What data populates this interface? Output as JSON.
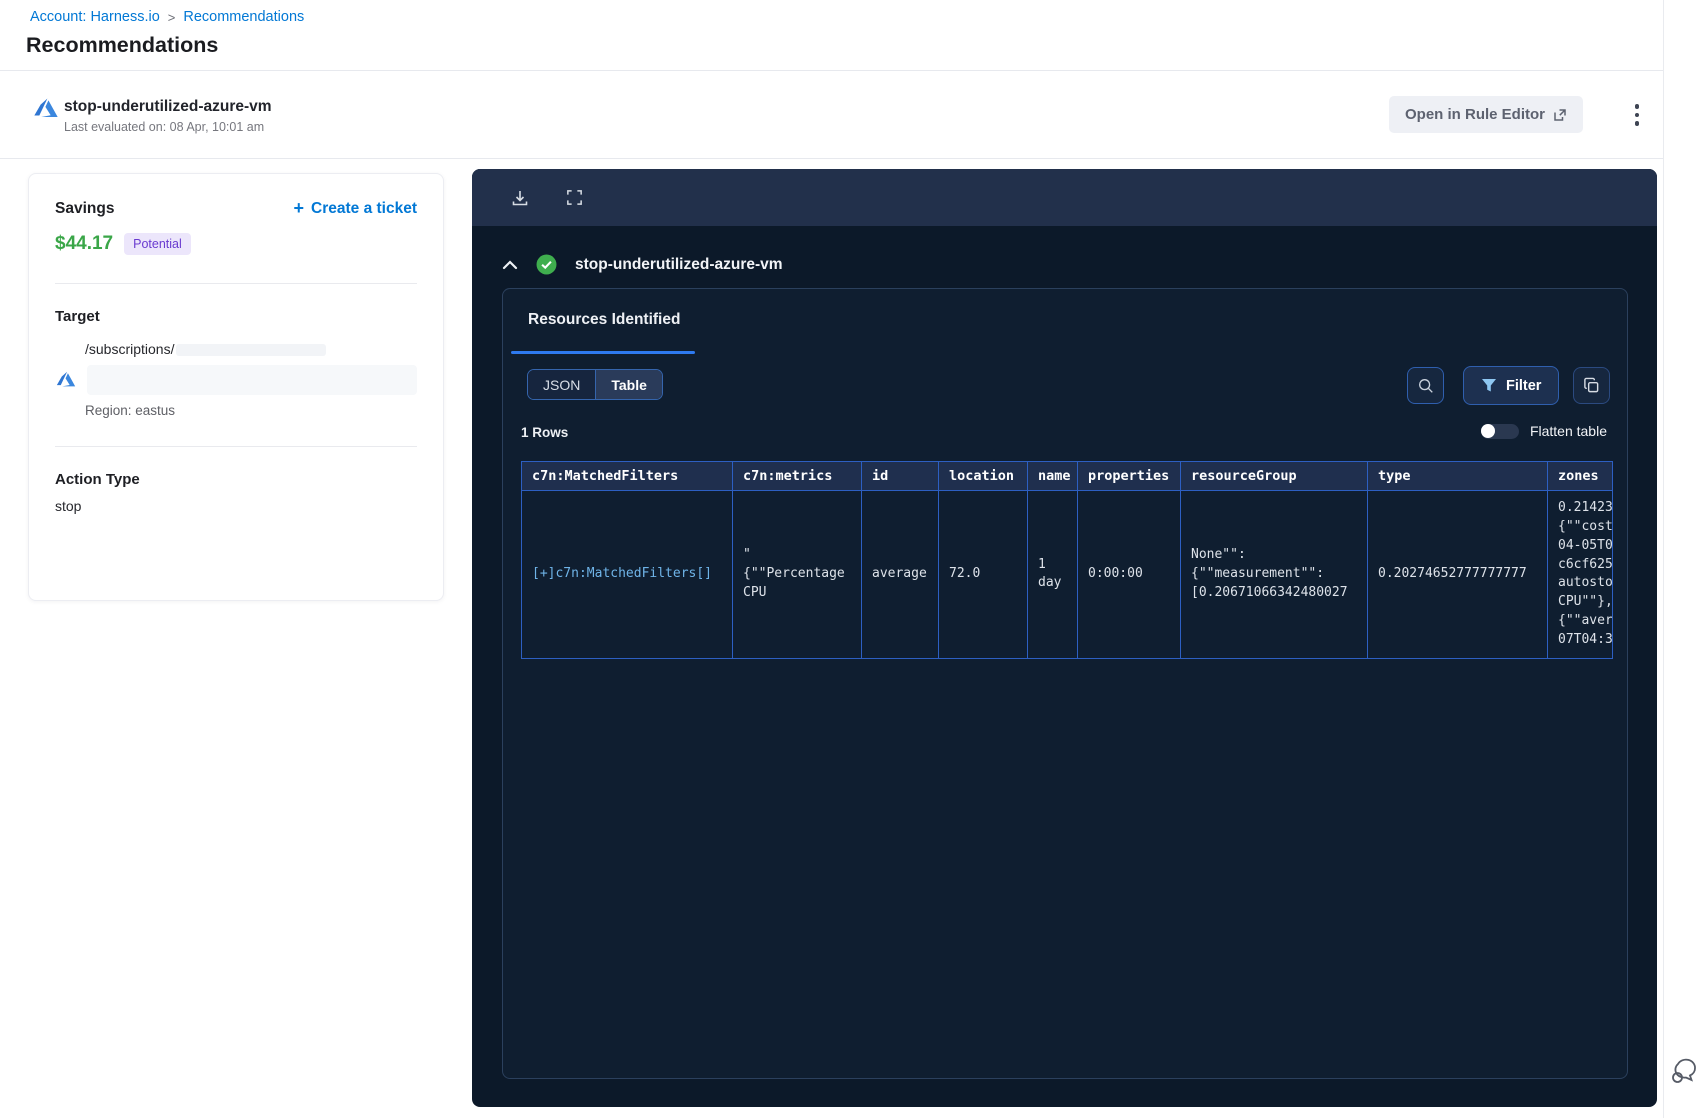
{
  "breadcrumb": {
    "account_link": "Account: Harness.io",
    "separator": ">",
    "current": "Recommendations"
  },
  "page_title": "Recommendations",
  "recommendation_header": {
    "name": "stop-underutilized-azure-vm",
    "last_evaluated": "Last evaluated on: 08 Apr, 10:01 am",
    "open_in_rule_editor": "Open in Rule Editor"
  },
  "details_card": {
    "savings_label": "Savings",
    "create_ticket_plus": "+",
    "create_ticket": "Create a ticket",
    "savings_amount": "$44.17",
    "savings_badge": "Potential",
    "target_label": "Target",
    "target_path": "/subscriptions/",
    "target_region": "Region: eastus",
    "action_type_label": "Action Type",
    "action_type_value": "stop"
  },
  "viewer_panel": {
    "resource_title": "stop-underutilized-azure-vm",
    "tab_resources": "Resources Identified",
    "view_toggle": {
      "json": "JSON",
      "table": "Table"
    },
    "filter_button": "Filter",
    "rows_count": "1 Rows",
    "flatten_toggle_label": "Flatten table",
    "table": {
      "headers": [
        "c7n:MatchedFilters",
        "c7n:metrics",
        "id",
        "location",
        "name",
        "properties",
        "resourceGroup",
        "type",
        "zones"
      ],
      "row": [
        "[+]c7n:MatchedFilters[]",
        "\"\n{\"\"Percentage\nCPU",
        "average",
        "72.0",
        "1 day",
        "0:00:00",
        "None\"\":\n{\"\"measurement\"\":\n[0.20671066342480027",
        "0.20274652777777777",
        "0.21423\n{\"\"cost\n04-05T0\nc6cf625\nautosto\nCPU\"\"},\n{\"\"aver\n07T04:3"
      ]
    }
  },
  "icons": {
    "azure": "azure-triangle-logo",
    "external_link": "arrow-out-of-box",
    "kebab": "three-vertical-dots",
    "download": "arrow-into-tray",
    "expand": "fullscreen-corners",
    "collapse": "chevron-up",
    "success": "green-check-circle",
    "search": "magnifier",
    "filter": "funnel",
    "copy": "two-overlapping-squares",
    "chat": "speech-bubbles"
  },
  "colors": {
    "link_blue": "#0278d5",
    "savings_green": "#3aa648",
    "badge_purple": "#6a3bd0",
    "panel_bg": "#0c1929",
    "panel_toolbar_bg": "#22304b",
    "table_border_blue": "#2d5fc2",
    "tab_underline_blue": "#2e7af0",
    "cell_link_blue": "#6fb4e8"
  }
}
